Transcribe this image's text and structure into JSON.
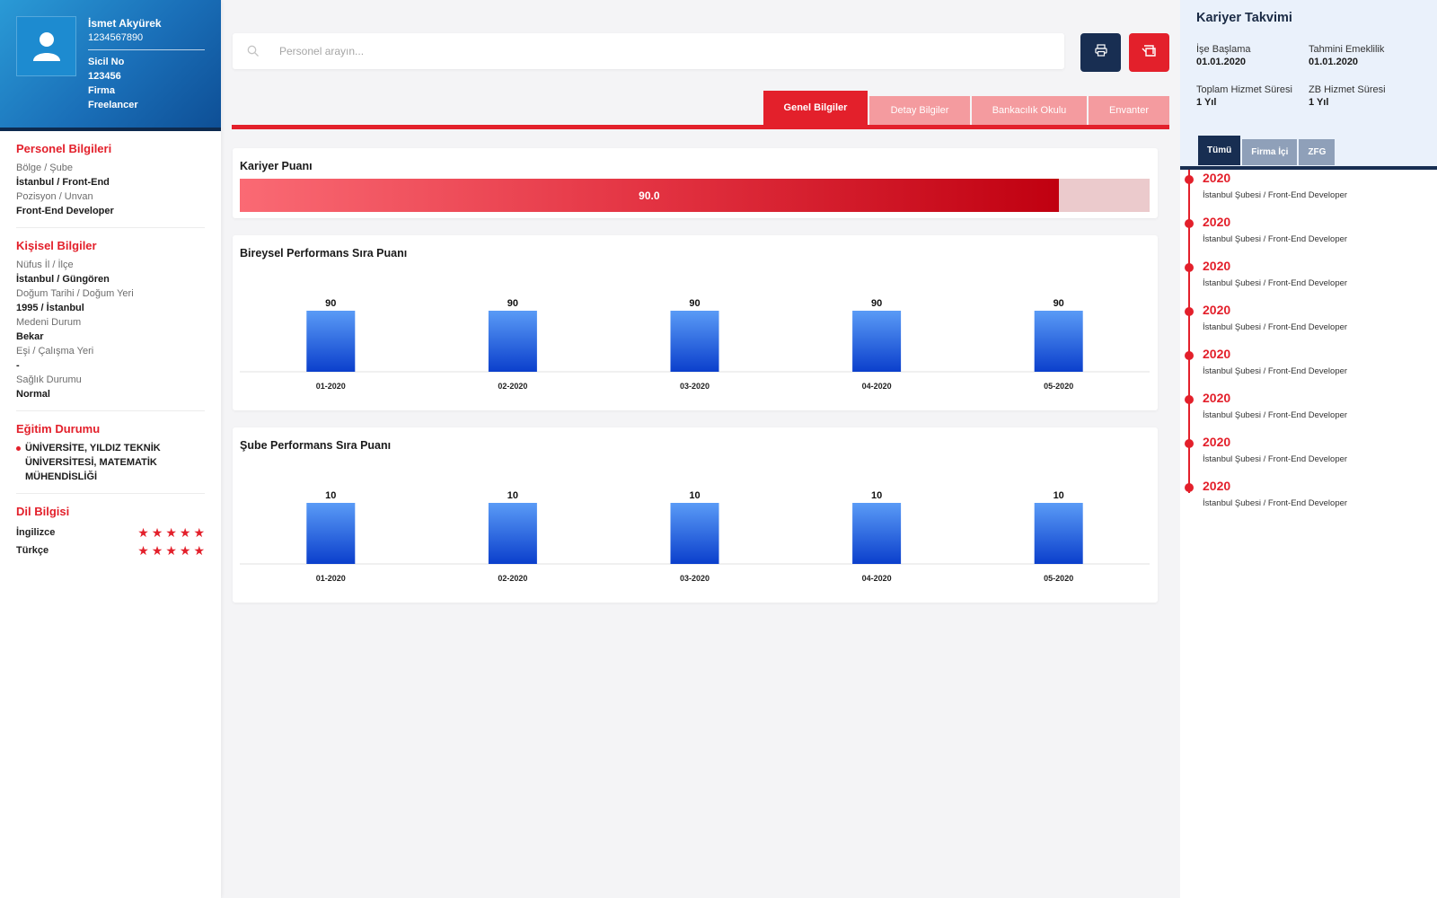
{
  "profile": {
    "name": "İsmet Akyürek",
    "phone": "1234567890",
    "sicil_label": "Sicil No",
    "sicil_value": "123456",
    "firma_label": "Firma",
    "firma_value": "Freelancer"
  },
  "personel": {
    "title": "Personel Bilgileri",
    "items": [
      {
        "label": "Bölge / Şube",
        "value": "İstanbul / Front-End"
      },
      {
        "label": "Pozisyon / Unvan",
        "value": "Front-End Developer"
      }
    ]
  },
  "kisisel": {
    "title": "Kişisel Bilgiler",
    "items": [
      {
        "label": "Nüfus İl / İlçe",
        "value": "İstanbul / Güngören"
      },
      {
        "label": "Doğum Tarihi / Doğum Yeri",
        "value": "1995 / İstanbul"
      },
      {
        "label": "Medeni Durum",
        "value": "Bekar"
      },
      {
        "label": "Eşi / Çalışma Yeri",
        "value": "-"
      },
      {
        "label": "Sağlık Durumu",
        "value": "Normal"
      }
    ]
  },
  "egitim": {
    "title": "Eğitim Durumu",
    "text": "ÜNİVERSİTE, YILDIZ TEKNİK ÜNİVERSİTESİ, MATEMATİK MÜHENDİSLİĞİ"
  },
  "dil": {
    "title": "Dil Bilgisi",
    "items": [
      {
        "name": "İngilizce",
        "rating": 5,
        "max": 5
      },
      {
        "name": "Türkçe",
        "rating": 5,
        "max": 5
      }
    ]
  },
  "search": {
    "placeholder": "Personel arayın..."
  },
  "icons": {
    "search": "search-icon",
    "print": "print-icon",
    "export": "export-icon",
    "avatar": "user-icon",
    "star": "star-icon"
  },
  "tabs": [
    {
      "label": "Genel Bilgiler",
      "active": true
    },
    {
      "label": "Detay Bilgiler",
      "active": false
    },
    {
      "label": "Bankacılık Okulu",
      "active": false
    },
    {
      "label": "Envanter",
      "active": false
    }
  ],
  "kariyer_puani": {
    "title": "Kariyer Puanı",
    "value": 90.0,
    "display": "90.0",
    "max": 100
  },
  "chart_data": [
    {
      "type": "bar",
      "title": "Bireysel Performans Sıra Puanı",
      "categories": [
        "01-2020",
        "02-2020",
        "03-2020",
        "04-2020",
        "05-2020"
      ],
      "values": [
        90,
        90,
        90,
        90,
        90
      ],
      "ylim": [
        0,
        90
      ]
    },
    {
      "type": "bar",
      "title": "Şube Performans Sıra Puanı",
      "categories": [
        "01-2020",
        "02-2020",
        "03-2020",
        "04-2020",
        "05-2020"
      ],
      "values": [
        10,
        10,
        10,
        10,
        10
      ],
      "ylim": [
        0,
        10
      ]
    }
  ],
  "kariyer_takvimi": {
    "title": "Kariyer Takvimi",
    "fields": [
      {
        "label": "İşe Başlama",
        "value": "01.01.2020"
      },
      {
        "label": "Tahmini Emeklilik",
        "value": "01.01.2020"
      },
      {
        "label": "Toplam Hizmet Süresi",
        "value": "1 Yıl"
      },
      {
        "label": "ZB Hizmet Süresi",
        "value": "1 Yıl"
      }
    ],
    "tabs": [
      {
        "label": "Tümü",
        "active": true
      },
      {
        "label": "Firma İçi",
        "active": false
      },
      {
        "label": "ZFG",
        "active": false
      }
    ],
    "timeline": [
      {
        "year": "2020",
        "desc": "İstanbul Şubesi / Front-End Developer"
      },
      {
        "year": "2020",
        "desc": "İstanbul Şubesi / Front-End Developer"
      },
      {
        "year": "2020",
        "desc": "İstanbul Şubesi / Front-End Developer"
      },
      {
        "year": "2020",
        "desc": "İstanbul Şubesi / Front-End Developer"
      },
      {
        "year": "2020",
        "desc": "İstanbul Şubesi / Front-End Developer"
      },
      {
        "year": "2020",
        "desc": "İstanbul Şubesi / Front-End Developer"
      },
      {
        "year": "2020",
        "desc": "İstanbul Şubesi / Front-End Developer"
      },
      {
        "year": "2020",
        "desc": "İstanbul Şubesi / Front-End Developer"
      }
    ]
  },
  "colors": {
    "accent": "#e3202b",
    "navy": "#182e52",
    "bar_top": "#5a9bf6",
    "bar_bottom": "#0b3fcc"
  }
}
